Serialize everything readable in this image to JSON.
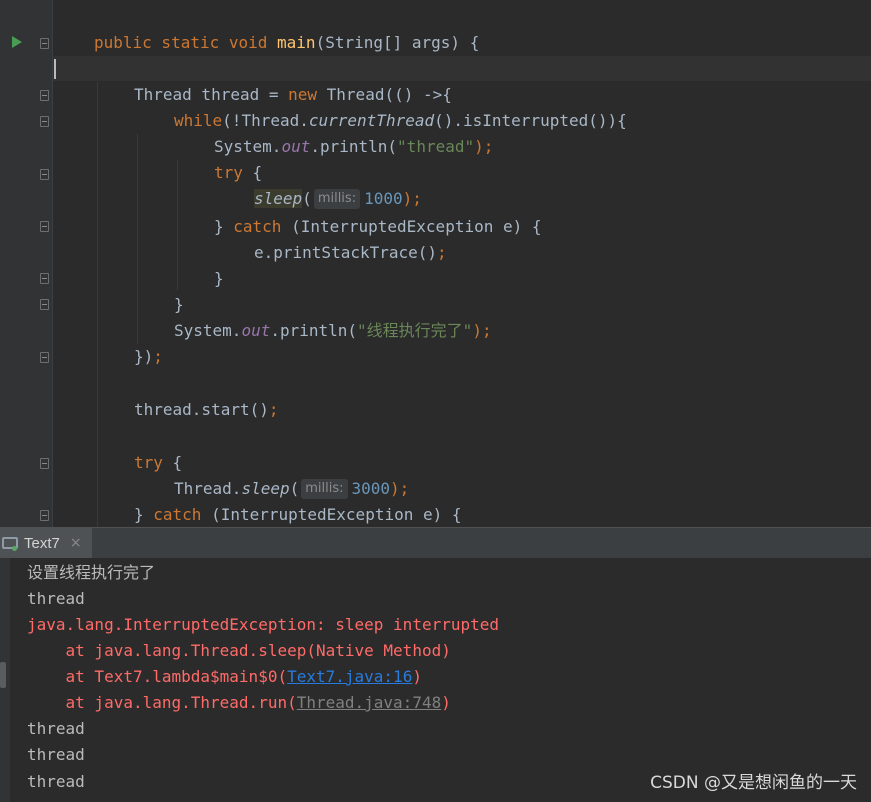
{
  "editor": {
    "lines": {
      "l1": {
        "k1": "public static void ",
        "fn": "main",
        "rest": "(String[] args) {"
      },
      "l3": {
        "a": "Thread thread = ",
        "kw": "new ",
        "b": "Thread(() ->{"
      },
      "l4": {
        "kw": "while",
        "a": "(!Thread.",
        "it": "currentThread",
        "b": "().isInterrupted()){"
      },
      "l5": {
        "a": "System.",
        "field": "out",
        "b": ".println(",
        "str": "\"thread\"",
        "semi": ");"
      },
      "l6": {
        "kw": "try ",
        "b": "{"
      },
      "l7": {
        "hl": "sleep",
        "a": "(",
        "hint": "millis:",
        "num": "1000",
        "semi": ");"
      },
      "l8": {
        "a": "} ",
        "kw": "catch ",
        "b": "(InterruptedException e) {"
      },
      "l9": {
        "a": "e.printStackTrace()",
        "semi": ";"
      },
      "l10": {
        "a": "}"
      },
      "l11": {
        "a": "}"
      },
      "l12": {
        "a": "System.",
        "field": "out",
        "b": ".println(",
        "str": "\"线程执行完了\"",
        "semi": ");"
      },
      "l13": {
        "a": "})",
        "semi": ";"
      },
      "l15": {
        "a": "thread.start()",
        "semi": ";"
      },
      "l17": {
        "kw": "try ",
        "b": "{"
      },
      "l18": {
        "a": "Thread.",
        "it": "sleep",
        "b": "(",
        "hint": "millis:",
        "num": "3000",
        "semi": ");"
      },
      "l19": {
        "a": "} ",
        "kw": "catch ",
        "b": "(InterruptedException e) {"
      }
    }
  },
  "console_tab": {
    "label": "Text7",
    "close": "×"
  },
  "console": {
    "lines": {
      "o1": "设置线程执行完了",
      "o2": "thread",
      "o3": "java.lang.InterruptedException: sleep interrupted",
      "o4": "    at java.lang.Thread.sleep(Native Method)",
      "o5a": "    at Text7.lambda$main$0(",
      "o5link": "Text7.java:16",
      "o5b": ")",
      "o6a": "    at java.lang.Thread.run(",
      "o6link": "Thread.java:748",
      "o6b": ")",
      "o7": "thread",
      "o8": "thread",
      "o9": "thread"
    }
  },
  "watermark": "CSDN @又是想闲鱼的一天",
  "colors": {
    "editor_bg": "#2b2b2b",
    "keyword": "#cc7832",
    "string": "#6a8759",
    "error": "#ff6b68",
    "link": "#287bde"
  }
}
